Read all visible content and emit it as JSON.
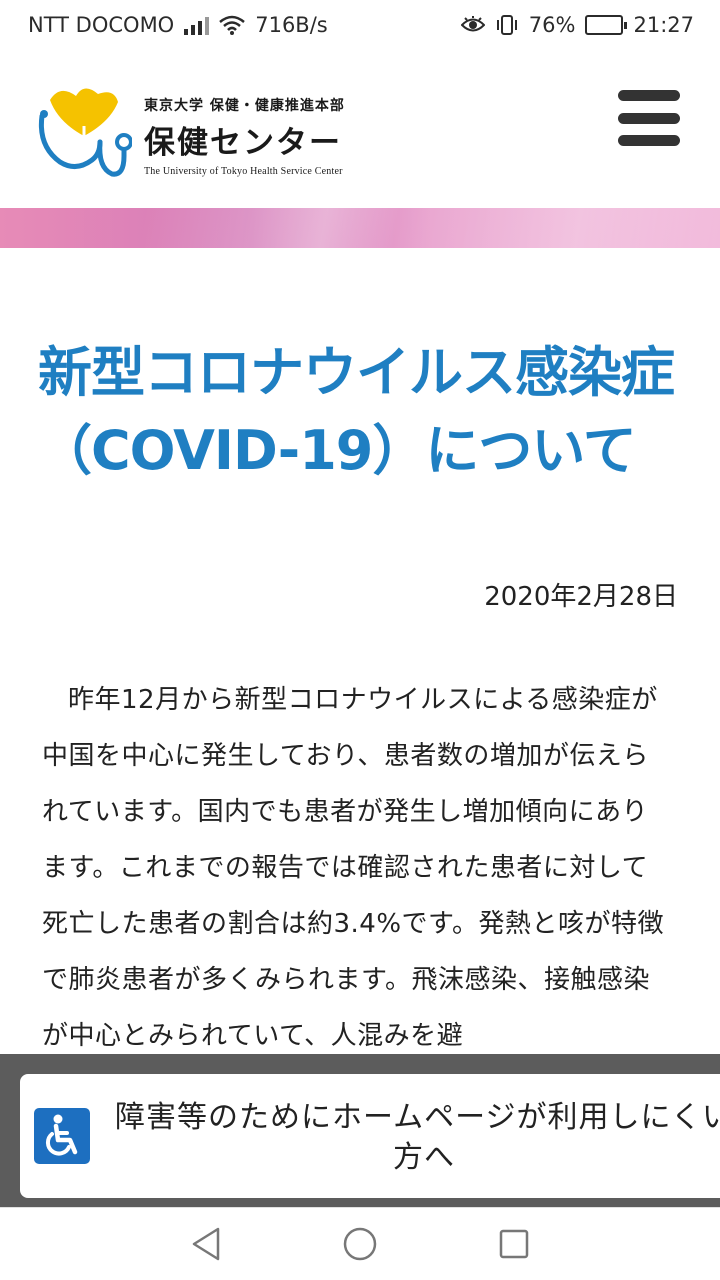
{
  "status_bar": {
    "carrier": "NTT DOCOMO",
    "net_speed": "716B/s",
    "battery": "76%",
    "battery_level": 0.76,
    "time": "21:27"
  },
  "header": {
    "org_small": "東京大学 保健・健康推進本部",
    "org_big": "保健センター",
    "org_en": "The University of Tokyo Health Service Center",
    "logo_colors": {
      "leaf": "#f5c200",
      "stethoscope": "#1f7fc2"
    },
    "menu_icon": "hamburger-menu-icon"
  },
  "article": {
    "title": "新型コロナウイルス感染症（COVID-19）について",
    "date": "2020年2月28日",
    "body": "昨年12月から新型コロナウイルスによる感染症が中国を中心に発生しており、患者数の増加が伝えられています。国内でも患者が発生し増加傾向にあります。これまでの報告では確認された患者に対して死亡した患者の割合は約3.4%です。発熱と咳が特徴で肺炎患者が多くみられます。飛沫感染、接触感染が中心とみられていて、人混みを避"
  },
  "accessibility": {
    "label": "障害等のためにホームページが利用しにくい方へ",
    "icon": "wheelchair-icon",
    "accent": "#1d6fc0"
  },
  "nav_bar": {
    "back": "back-triangle-icon",
    "home": "home-circle-icon",
    "recents": "recents-square-icon"
  },
  "colors": {
    "title_blue": "#1f7fc2",
    "banner_pink": "#e78bb7"
  }
}
